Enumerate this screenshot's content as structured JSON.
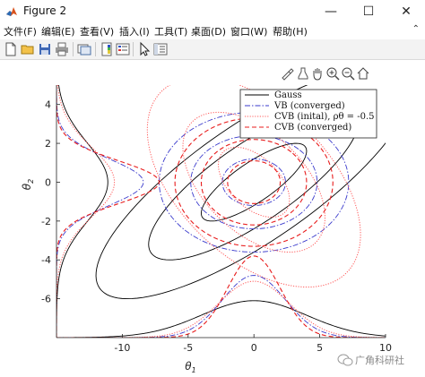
{
  "window": {
    "title": "Figure 2",
    "controls": {
      "minimize": "—",
      "maximize": "☐",
      "close": "✕"
    }
  },
  "menu": {
    "items": [
      "文件(F)",
      "编辑(E)",
      "查看(V)",
      "插入(I)",
      "工具(T)",
      "桌面(D)",
      "窗口(W)",
      "帮助(H)"
    ],
    "overflow_icon": "chevron-up-icon"
  },
  "toolbar": {
    "icons": [
      "new-figure-icon",
      "open-file-icon",
      "save-icon",
      "print-icon",
      "link-icon",
      "colorbar-icon",
      "legend-icon",
      "pointer-icon",
      "property-inspector-icon"
    ]
  },
  "axes_toolbar": {
    "icons": [
      "brush-icon",
      "export-icon",
      "pan-hand-icon",
      "zoom-in-icon",
      "zoom-out-icon",
      "home-icon"
    ]
  },
  "chart_data": {
    "type": "line",
    "xlabel": "θ1",
    "ylabel": "θ2",
    "xlim": [
      -15,
      10
    ],
    "ylim": [
      -8,
      5
    ],
    "xticks": [
      -10,
      -5,
      0,
      5,
      10
    ],
    "yticks": [
      -6,
      -4,
      -2,
      0,
      2,
      4
    ],
    "grid": false,
    "legend_position": "top-right",
    "series": [
      {
        "name": "Gauss",
        "style": "solid",
        "color": "#000000",
        "mean": [
          0,
          0
        ],
        "sd": [
          4,
          2
        ],
        "corr": 0.8,
        "contour_levels": [
          1,
          2,
          3
        ]
      },
      {
        "name": "VB (converged)",
        "style": "dashdot",
        "color": "#3a3acc",
        "mean": [
          0,
          0
        ],
        "sd": [
          2.4,
          1.2
        ],
        "corr": 0,
        "contour_levels": [
          1,
          2,
          3
        ]
      },
      {
        "name": "CVB (inital), ρθ = -0.5",
        "style": "dotted",
        "color": "#ff5a5a",
        "mean": [
          0,
          0
        ],
        "sd": [
          2.7,
          1.8
        ],
        "corr": -0.5,
        "contour_levels": [
          1,
          2,
          3
        ]
      },
      {
        "name": "CVB (converged)",
        "style": "dashed",
        "color": "#e81c1c",
        "mean": [
          0,
          0
        ],
        "sd": [
          2.0,
          1.1
        ],
        "corr": 0,
        "contour_levels": [
          1,
          2,
          3
        ]
      }
    ],
    "marginal_x": {
      "baseline_y": -8,
      "x": [
        -15,
        10
      ],
      "peaks": {
        "Gauss": 1.9,
        "VB (converged)": 3.2,
        "CVB (inital), ρθ = -0.5": 2.9,
        "CVB (converged)": 4.2
      }
    },
    "marginal_y": {
      "baseline_x": -15,
      "y": [
        -8,
        5
      ],
      "peaks": {
        "Gauss": 3.9,
        "VB (converged)": 6.6,
        "CVB (inital), ρθ = -0.5": 4.4,
        "CVB (converged)": 7.8
      }
    }
  },
  "watermark": {
    "text": "广角科研社"
  }
}
